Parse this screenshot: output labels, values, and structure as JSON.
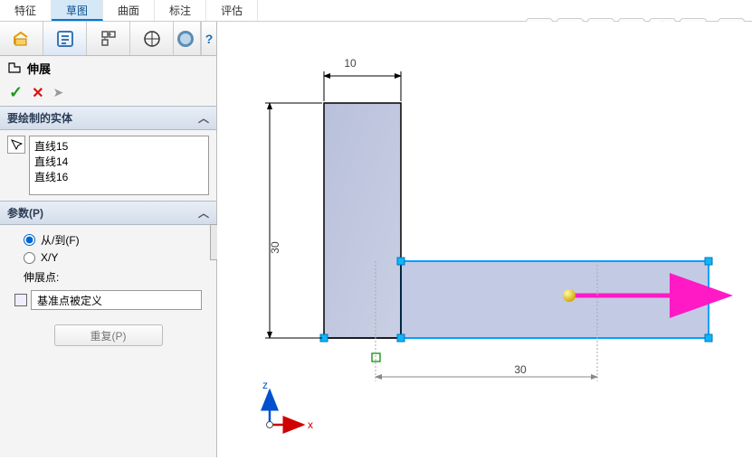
{
  "tabs": {
    "t0": "特征",
    "t1": "草图",
    "t2": "曲面",
    "t3": "标注",
    "t4": "评估"
  },
  "feature": {
    "title": "伸展"
  },
  "sections": {
    "entities_title": "要绘制的实体",
    "params_title": "参数(P)"
  },
  "entities": {
    "e0": "直线15",
    "e1": "直线14",
    "e2": "直线16"
  },
  "params": {
    "fromto": "从/到(F)",
    "xy": "X/Y",
    "extend_point": "伸展点:",
    "datum_defined": "基准点被定义"
  },
  "repeat_label": "重复(P)",
  "dims": {
    "top": "10",
    "left": "30",
    "bottom": "30"
  },
  "triad": {
    "x": "x",
    "z": "z"
  },
  "icons": {
    "zoom-fit": "",
    "zoom-area": "",
    "pan": "",
    "section": "",
    "lightning": "",
    "view": "",
    "cube": ""
  }
}
